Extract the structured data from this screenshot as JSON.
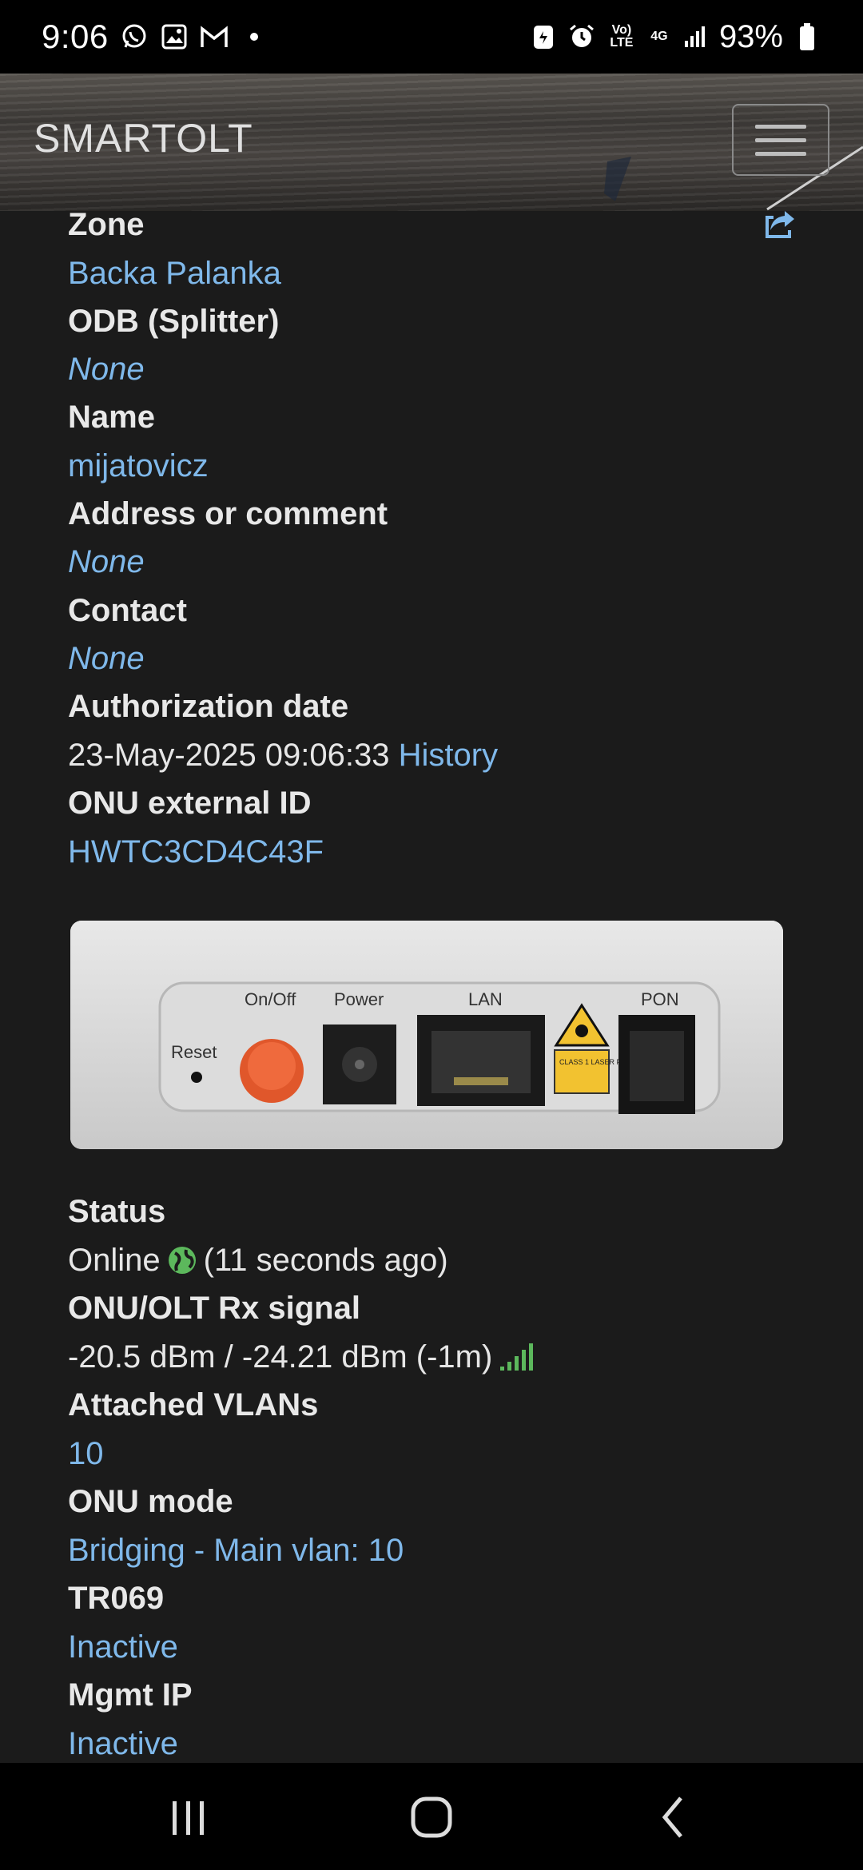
{
  "status_bar": {
    "time": "9:06",
    "battery": "93%",
    "volte": "Vo) LTE",
    "network": "4G"
  },
  "header": {
    "brand": "SMARTOLT"
  },
  "fields": {
    "zone_label": "Zone",
    "zone_value": "Backa Palanka",
    "odb_label": "ODB (Splitter)",
    "odb_value": "None",
    "name_label": "Name",
    "name_value": "mijatovicz",
    "address_label": "Address or comment",
    "address_value": "None",
    "contact_label": "Contact",
    "contact_value": "None",
    "auth_label": "Authorization date",
    "auth_value": "23-May-2025 09:06:33",
    "auth_history": "History",
    "extid_label": "ONU external ID",
    "extid_value": "HWTC3CD4C43F",
    "status_label": "Status",
    "status_value": "Online",
    "status_ago": "(11 seconds ago)",
    "rx_label": "ONU/OLT Rx signal",
    "rx_value": "-20.5 dBm / -24.21 dBm (-1m)",
    "vlans_label": "Attached VLANs",
    "vlans_value": "10",
    "mode_label": "ONU mode",
    "mode_value": "Bridging - Main vlan: 10",
    "tr069_label": "TR069",
    "tr069_value": "Inactive",
    "mgmt_label": "Mgmt IP",
    "mgmt_value": "Inactive"
  },
  "device_image": {
    "labels": {
      "reset": "Reset",
      "onoff": "On/Off",
      "power": "Power",
      "lan": "LAN",
      "pon": "PON",
      "laser": "CLASS 1 LASER PRODUCT"
    }
  },
  "colors": {
    "background": "#1b1b1b",
    "link": "#7fb8ea",
    "online_green": "#5cb85c"
  }
}
